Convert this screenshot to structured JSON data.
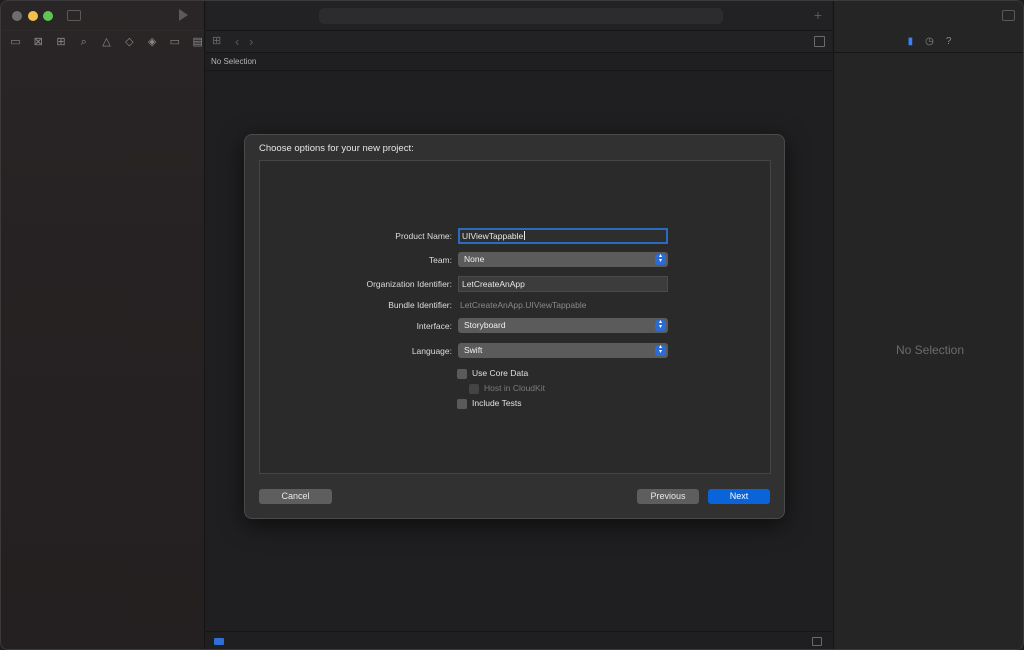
{
  "editor": {
    "jump_bar": "No Selection"
  },
  "inspector": {
    "empty_state": "No Selection",
    "tabs": [
      "file-inspector-icon",
      "history-icon",
      "help-icon"
    ]
  },
  "dialog": {
    "title": "Choose options for your new project:",
    "fields": {
      "product_name": {
        "label": "Product Name:",
        "value": "UIViewTappable"
      },
      "team": {
        "label": "Team:",
        "value": "None"
      },
      "organization_identifier": {
        "label": "Organization Identifier:",
        "value": "LetCreateAnApp"
      },
      "bundle_identifier": {
        "label": "Bundle Identifier:",
        "value": "LetCreateAnApp.UIViewTappable"
      },
      "interface": {
        "label": "Interface:",
        "value": "Storyboard"
      },
      "language": {
        "label": "Language:",
        "value": "Swift"
      }
    },
    "checkboxes": {
      "use_core_data": {
        "label": "Use Core Data",
        "checked": false
      },
      "host_in_cloudkit": {
        "label": "Host in CloudKit",
        "checked": false,
        "enabled": false
      },
      "include_tests": {
        "label": "Include Tests",
        "checked": false
      }
    },
    "buttons": {
      "cancel": "Cancel",
      "previous": "Previous",
      "next": "Next"
    }
  },
  "colors": {
    "accent": "#0a64d9",
    "focus_ring": "#2a6bbd"
  }
}
